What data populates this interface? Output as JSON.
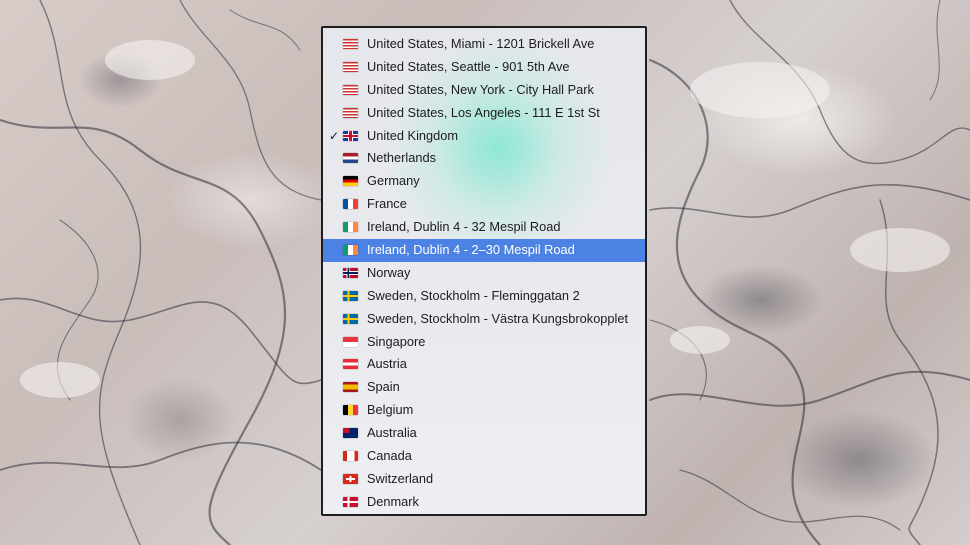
{
  "menu": {
    "items": [
      {
        "label": "United States, Miami - 1201 Brickell Ave",
        "flag": "us-flag-icon",
        "checked": false,
        "selected": false
      },
      {
        "label": "United States, Seattle - 901 5th Ave",
        "flag": "us-flag-icon",
        "checked": false,
        "selected": false
      },
      {
        "label": "United States, New York - City Hall Park",
        "flag": "us-flag-icon",
        "checked": false,
        "selected": false
      },
      {
        "label": "United States, Los Angeles - 111 E 1st St",
        "flag": "us-flag-icon",
        "checked": false,
        "selected": false
      },
      {
        "label": "United Kingdom",
        "flag": "uk-flag-icon",
        "checked": true,
        "selected": false
      },
      {
        "label": "Netherlands",
        "flag": "nl-flag-icon",
        "checked": false,
        "selected": false
      },
      {
        "label": "Germany",
        "flag": "de-flag-icon",
        "checked": false,
        "selected": false
      },
      {
        "label": "France",
        "flag": "fr-flag-icon",
        "checked": false,
        "selected": false
      },
      {
        "label": "Ireland, Dublin 4 - 32 Mespil Road",
        "flag": "ie-flag-icon",
        "checked": false,
        "selected": false
      },
      {
        "label": "Ireland, Dublin 4 - 2–30 Mespil Road",
        "flag": "ie-flag-icon",
        "checked": false,
        "selected": true
      },
      {
        "label": "Norway",
        "flag": "no-flag-icon",
        "checked": false,
        "selected": false
      },
      {
        "label": "Sweden, Stockholm - Fleminggatan 2",
        "flag": "se-flag-icon",
        "checked": false,
        "selected": false
      },
      {
        "label": "Sweden, Stockholm - Västra Kungsbrokopplet",
        "flag": "se-flag-icon",
        "checked": false,
        "selected": false
      },
      {
        "label": "Singapore",
        "flag": "sg-flag-icon",
        "checked": false,
        "selected": false
      },
      {
        "label": "Austria",
        "flag": "at-flag-icon",
        "checked": false,
        "selected": false
      },
      {
        "label": "Spain",
        "flag": "es-flag-icon",
        "checked": false,
        "selected": false
      },
      {
        "label": "Belgium",
        "flag": "be-flag-icon",
        "checked": false,
        "selected": false
      },
      {
        "label": "Australia",
        "flag": "au-flag-icon",
        "checked": false,
        "selected": false
      },
      {
        "label": "Canada",
        "flag": "ca-flag-icon",
        "checked": false,
        "selected": false
      },
      {
        "label": "Switzerland",
        "flag": "ch-flag-icon",
        "checked": false,
        "selected": false
      },
      {
        "label": "Denmark",
        "flag": "dk-flag-icon",
        "checked": false,
        "selected": false
      }
    ],
    "check_symbol": "✓",
    "selection_color": "#4c82e3"
  }
}
